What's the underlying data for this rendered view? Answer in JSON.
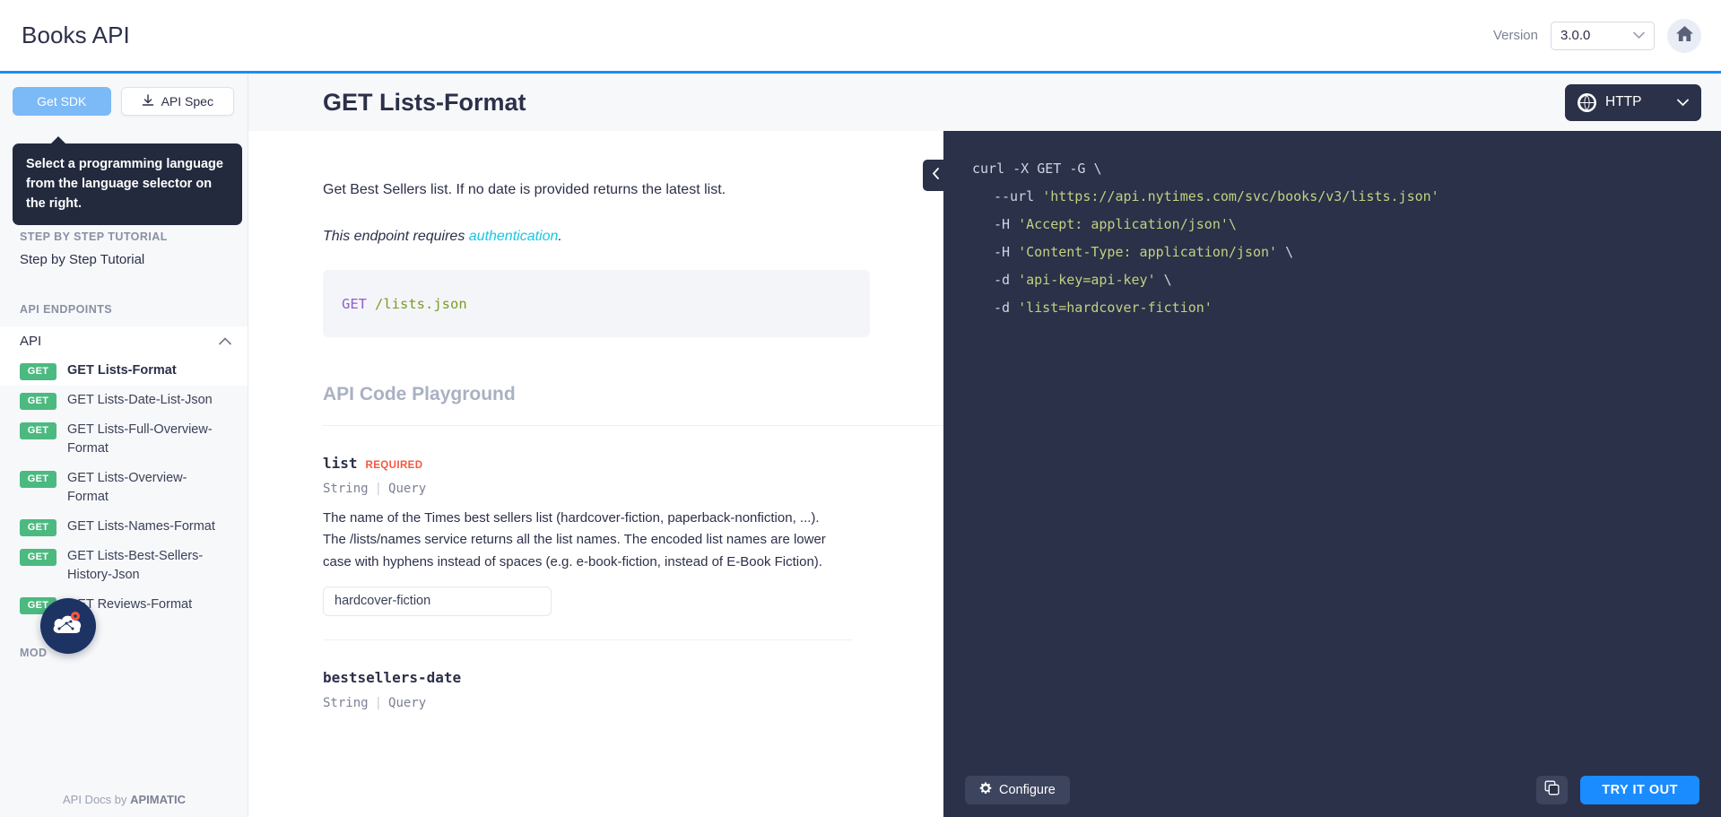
{
  "header": {
    "brand": "Books API",
    "version_label": "Version",
    "version_value": "3.0.0",
    "home_icon": "home-icon",
    "chevron_icon": "chevron-down-icon",
    "accent_color": "#1a8cff"
  },
  "sidebar": {
    "get_sdk_label": "Get SDK",
    "api_spec_label": "API Spec",
    "download_icon": "download-icon",
    "tooltip": "Select a programming language from the language selector on the right.",
    "tutorial_section_title": "STEP BY STEP TUTORIAL",
    "tutorial_item": "Step by Step Tutorial",
    "endpoints_section_title": "API ENDPOINTS",
    "group_label": "API",
    "group_chevron": "chevron-up-icon",
    "models_section_title": "MOD",
    "verb": "GET",
    "verb_color": "#4cba80",
    "endpoints": [
      {
        "verb": "GET",
        "label": "GET Lists-Format"
      },
      {
        "verb": "GET",
        "label": "GET Lists-Date-List-Json"
      },
      {
        "verb": "GET",
        "label": "GET Lists-Full-Overview-Format"
      },
      {
        "verb": "GET",
        "label": "GET Lists-Overview-Format"
      },
      {
        "verb": "GET",
        "label": "GET Lists-Names-Format"
      },
      {
        "verb": "GET",
        "label": "GET Lists-Best-Sellers-History-Json"
      },
      {
        "verb": "GET",
        "label": "GET Reviews-Format"
      }
    ],
    "footer_prefix": "API Docs by ",
    "footer_brand": "APIMATIC",
    "chat_icon": "chat-widget-icon"
  },
  "main": {
    "title": "GET Lists-Format",
    "description": "Get Best Sellers list. If no date is provided returns the latest list.",
    "auth_prefix": "This endpoint requires ",
    "auth_link": "authentication",
    "auth_suffix": ".",
    "endpoint_method": "GET",
    "endpoint_path": "/lists.json",
    "playground_title": "API Code Playground",
    "parameters": [
      {
        "name": "list",
        "required_badge": "REQUIRED",
        "type": "String",
        "location": "Query",
        "description": "The name of the Times best sellers list (hardcover-fiction, paperback-nonfiction, ...). The /lists/names service returns all the list names. The encoded list names are lower case with hyphens instead of spaces (e.g. e-book-fiction, instead of E-Book Fiction).",
        "value": "hardcover-fiction"
      },
      {
        "name": "bestsellers-date",
        "required_badge": "",
        "type": "String",
        "location": "Query",
        "description": "",
        "value": ""
      }
    ]
  },
  "code_panel": {
    "language": "HTTP",
    "globe_icon": "globe-icon",
    "chevron_icon": "chevron-down-icon",
    "collapse_icon": "chevron-left-icon",
    "snippet_line1": "curl -X GET -G \\",
    "snippet_line2_pre": "--url ",
    "snippet_line2_str": "'https://api.nytimes.com/svc/books/v3/lists.json'",
    "snippet_line3_pre": "-H ",
    "snippet_line3_str": "'Accept: application/json'\\",
    "snippet_line4_pre": "-H ",
    "snippet_line4_str": "'Content-Type: application/json'",
    "snippet_line4_post": " \\",
    "snippet_line5_pre": "-d ",
    "snippet_line5_str": "'api-key=api-key'",
    "snippet_line5_post": " \\",
    "snippet_line6_pre": "-d ",
    "snippet_line6_str": "'list=hardcover-fiction'",
    "configure_label": "Configure",
    "gear_icon": "gear-icon",
    "copy_icon": "copy-icon",
    "try_it_out_label": "TRY IT OUT",
    "try_color": "#1a8cff"
  }
}
